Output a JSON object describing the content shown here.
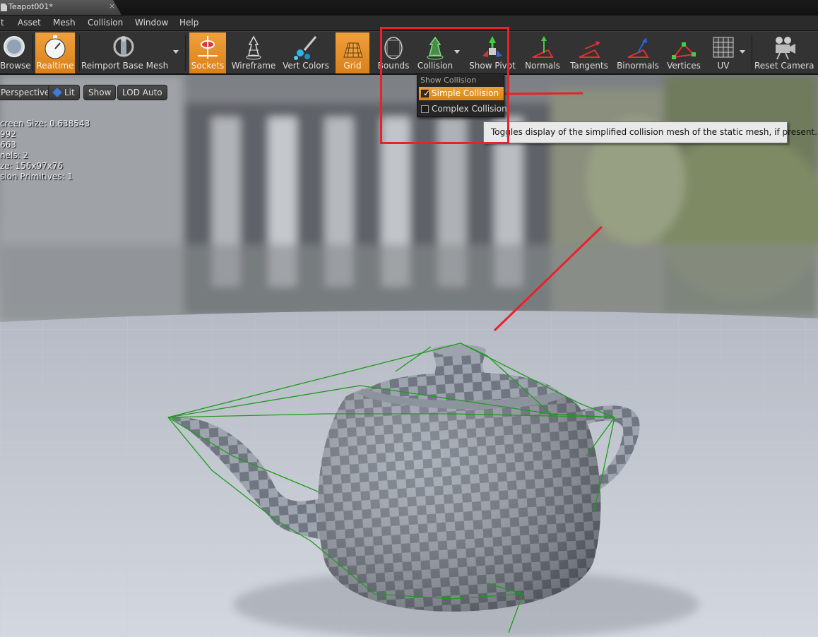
{
  "tab": {
    "title": "Teapot001*",
    "close": "×"
  },
  "menu": [
    "t",
    "Asset",
    "Mesh",
    "Collision",
    "Window",
    "Help"
  ],
  "toolbar": {
    "browse": "Browse",
    "realtime": "Realtime",
    "reimport": "Reimport Base Mesh",
    "sockets": "Sockets",
    "wireframe": "Wireframe",
    "vert_colors": "Vert Colors",
    "grid": "Grid",
    "bounds": "Bounds",
    "collision": "Collision",
    "show_pivot": "Show Pivot",
    "normals": "Normals",
    "tangents": "Tangents",
    "binormals": "Binormals",
    "vertices": "Vertices",
    "uv": "UV",
    "reset_camera": "Reset Camera"
  },
  "viewport_options": {
    "perspective": "Perspective",
    "lit": "Lit",
    "show": "Show",
    "lod": "LOD Auto"
  },
  "stats": [
    "creen Size:  0.638543",
    "  992",
    "663",
    "nels:  2",
    "ze: 156x97x76",
    "sion Primitives:  1"
  ],
  "collision_menu": {
    "header": "Show Collision",
    "simple": "Simple Collision",
    "complex": "Complex Collision",
    "simple_checked": true,
    "complex_checked": false
  },
  "tooltip": "Toggles display of the simplified collision mesh of the static mesh, if present.",
  "colors": {
    "accent": "#e8952f",
    "annotation": "#e8222a",
    "collision_wire": "#1f9a1f"
  }
}
